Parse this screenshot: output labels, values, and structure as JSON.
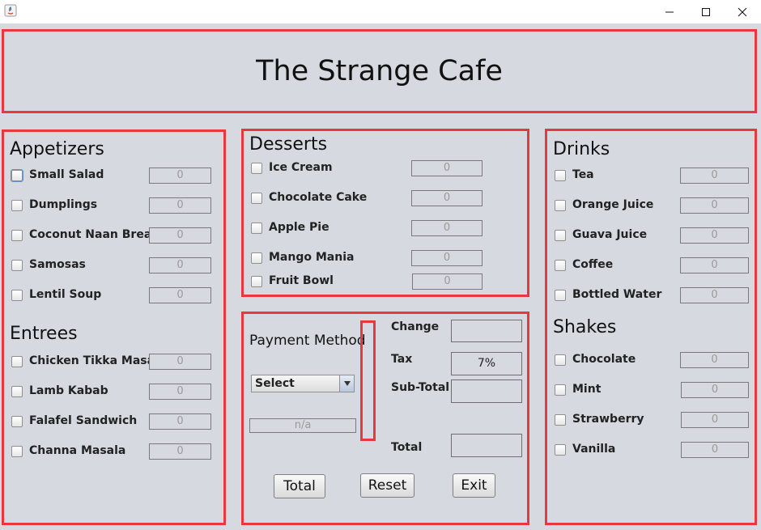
{
  "window": {
    "controls": [
      "minimize-icon",
      "maximize-icon",
      "close-icon"
    ]
  },
  "header": {
    "title": "The Strange Cafe"
  },
  "appetizers": {
    "title": "Appetizers",
    "items": [
      {
        "label": "Small Salad",
        "qty": "0"
      },
      {
        "label": "Dumplings",
        "qty": "0"
      },
      {
        "label": "Coconut Naan Bread",
        "qty": "0"
      },
      {
        "label": "Samosas",
        "qty": "0"
      },
      {
        "label": "Lentil Soup",
        "qty": "0"
      }
    ]
  },
  "entrees": {
    "title": "Entrees",
    "items": [
      {
        "label": "Chicken Tikka Masala",
        "qty": "0"
      },
      {
        "label": "Lamb Kabab",
        "qty": "0"
      },
      {
        "label": "Falafel Sandwich",
        "qty": "0"
      },
      {
        "label": "Channa Masala",
        "qty": "0"
      }
    ]
  },
  "desserts": {
    "title": "Desserts",
    "items": [
      {
        "label": "Ice Cream",
        "qty": "0"
      },
      {
        "label": "Chocolate Cake",
        "qty": "0"
      },
      {
        "label": "Apple Pie",
        "qty": "0"
      },
      {
        "label": "Mango Mania",
        "qty": "0"
      },
      {
        "label": "Fruit Bowl",
        "qty": "0"
      }
    ]
  },
  "drinks": {
    "title": "Drinks",
    "items": [
      {
        "label": "Tea",
        "qty": "0"
      },
      {
        "label": "Orange Juice",
        "qty": "0"
      },
      {
        "label": "Guava Juice",
        "qty": "0"
      },
      {
        "label": "Coffee",
        "qty": "0"
      },
      {
        "label": "Bottled Water",
        "qty": "0"
      }
    ]
  },
  "shakes": {
    "title": "Shakes",
    "items": [
      {
        "label": "Chocolate",
        "qty": "0"
      },
      {
        "label": "Mint",
        "qty": "0"
      },
      {
        "label": "Strawberry",
        "qty": "0"
      },
      {
        "label": "Vanilla",
        "qty": "0"
      }
    ]
  },
  "payment": {
    "method_label": "Payment Method",
    "method_selected": "Select",
    "method_field": "n/a",
    "change_label": "Change",
    "change_value": "",
    "tax_label": "Tax",
    "tax_value": "7%",
    "subtotal_label": "Sub-Total",
    "subtotal_value": "",
    "total_label": "Total",
    "total_value": ""
  },
  "buttons": {
    "total": "Total",
    "reset": "Reset",
    "exit": "Exit"
  },
  "colors": {
    "accent_border": "#e8383d",
    "background": "#d6d9df"
  }
}
